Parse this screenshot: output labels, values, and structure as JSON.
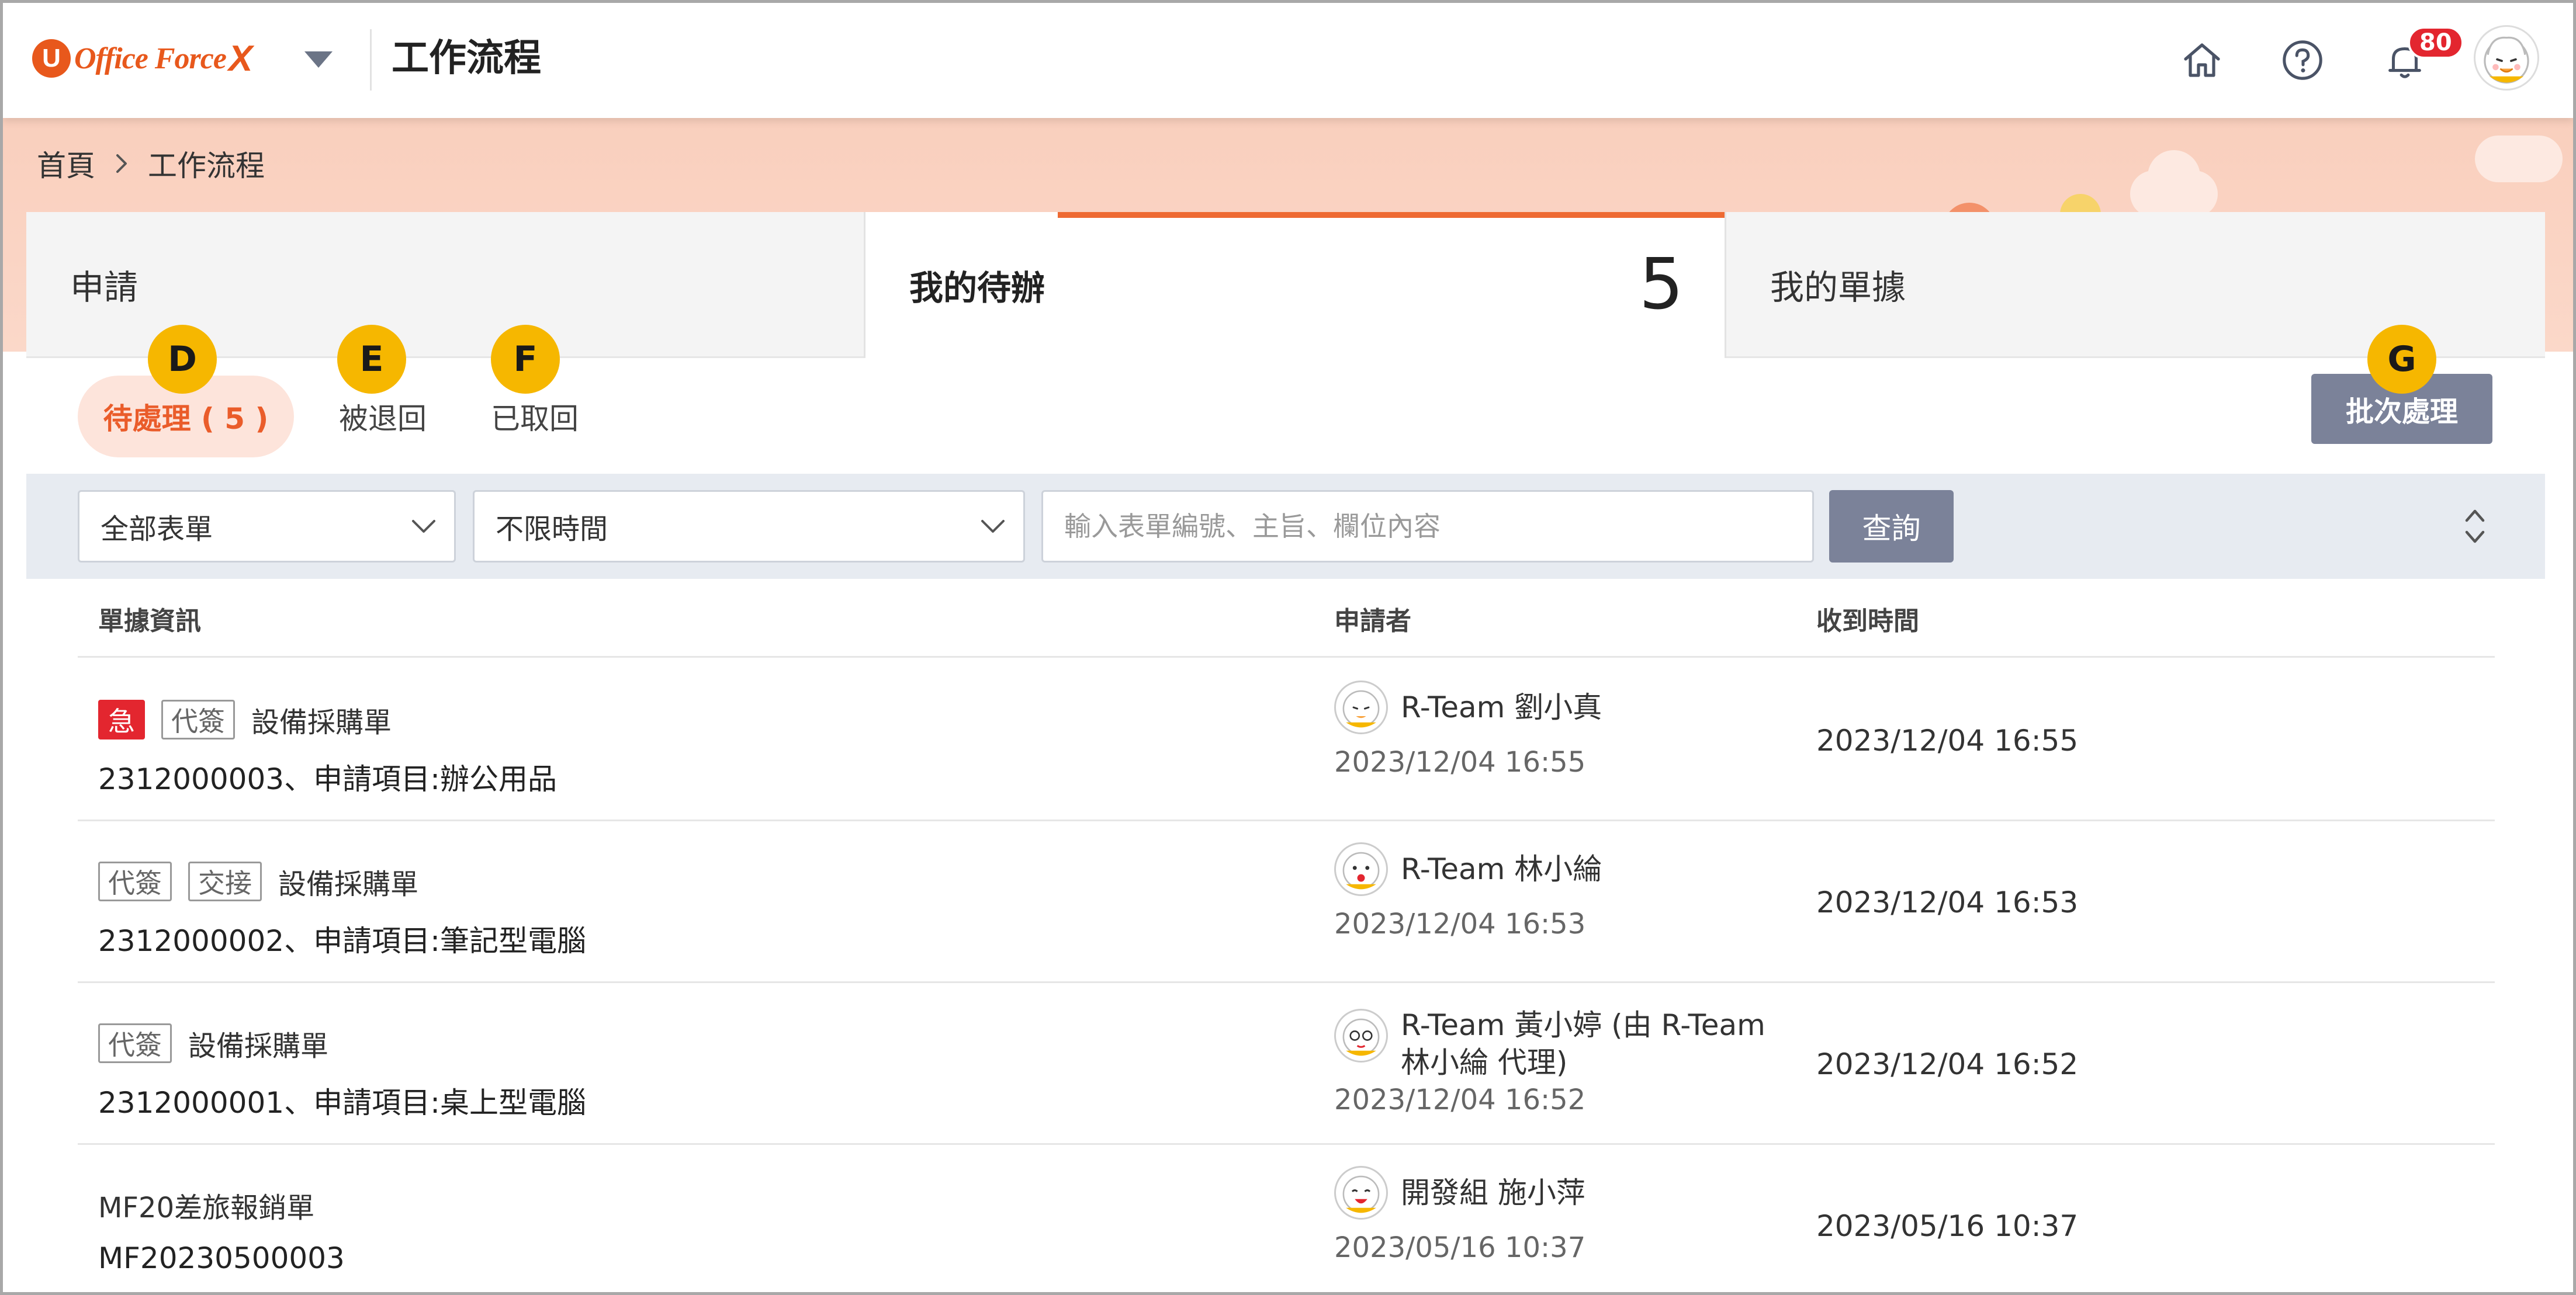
{
  "header": {
    "logo_mark": "U",
    "logo_text": "Office Force",
    "logo_x": "X",
    "page_title": "工作流程",
    "notifications_count": "80"
  },
  "breadcrumb": {
    "home": "首頁",
    "current": "工作流程"
  },
  "tabs": {
    "apply": "申請",
    "todo": "我的待辦",
    "todo_count": "5",
    "my_forms": "我的單據"
  },
  "subtabs": {
    "pending": "待處理 ( 5 )",
    "returned": "被退回",
    "withdrawn": "已取回"
  },
  "markers": {
    "d": "D",
    "e": "E",
    "f": "F",
    "g": "G"
  },
  "batch_button": "批次處理",
  "filters": {
    "form_select": "全部表單",
    "time_select": "不限時間",
    "search_placeholder": "輸入表單編號、主旨、欄位內容",
    "query_button": "查詢"
  },
  "table": {
    "columns": {
      "info": "單據資訊",
      "applicant": "申請者",
      "received": "收到時間"
    },
    "rows": [
      {
        "tags": [
          "急",
          "代簽"
        ],
        "form_name": "設備採購單",
        "detail": "2312000003、申請項目:辦公用品",
        "applicant": "R-Team 劉小真",
        "applied_time": "2023/12/04 16:55",
        "received_time": "2023/12/04 16:55"
      },
      {
        "tags": [
          "代簽",
          "交接"
        ],
        "form_name": "設備採購單",
        "detail": "2312000002、申請項目:筆記型電腦",
        "applicant": "R-Team 林小綸",
        "applied_time": "2023/12/04 16:53",
        "received_time": "2023/12/04 16:53"
      },
      {
        "tags": [
          "代簽"
        ],
        "form_name": "設備採購單",
        "detail": "2312000001、申請項目:桌上型電腦",
        "applicant": "R-Team  黃小婷  (由 R-Team 林小綸 代理)",
        "applied_time": "2023/12/04 16:52",
        "received_time": "2023/12/04 16:52"
      },
      {
        "tags": [],
        "form_name": "MF20差旅報銷單",
        "detail": "MF20230500003",
        "applicant": "開發組 施小萍",
        "applied_time": "2023/05/16 10:37",
        "received_time": "2023/05/16 10:37"
      }
    ]
  },
  "colors": {
    "accent": "#ee6a33",
    "banner": "#f9cfbd",
    "button": "#7b8299",
    "marker": "#f6b700",
    "urgent": "#e3262f"
  }
}
